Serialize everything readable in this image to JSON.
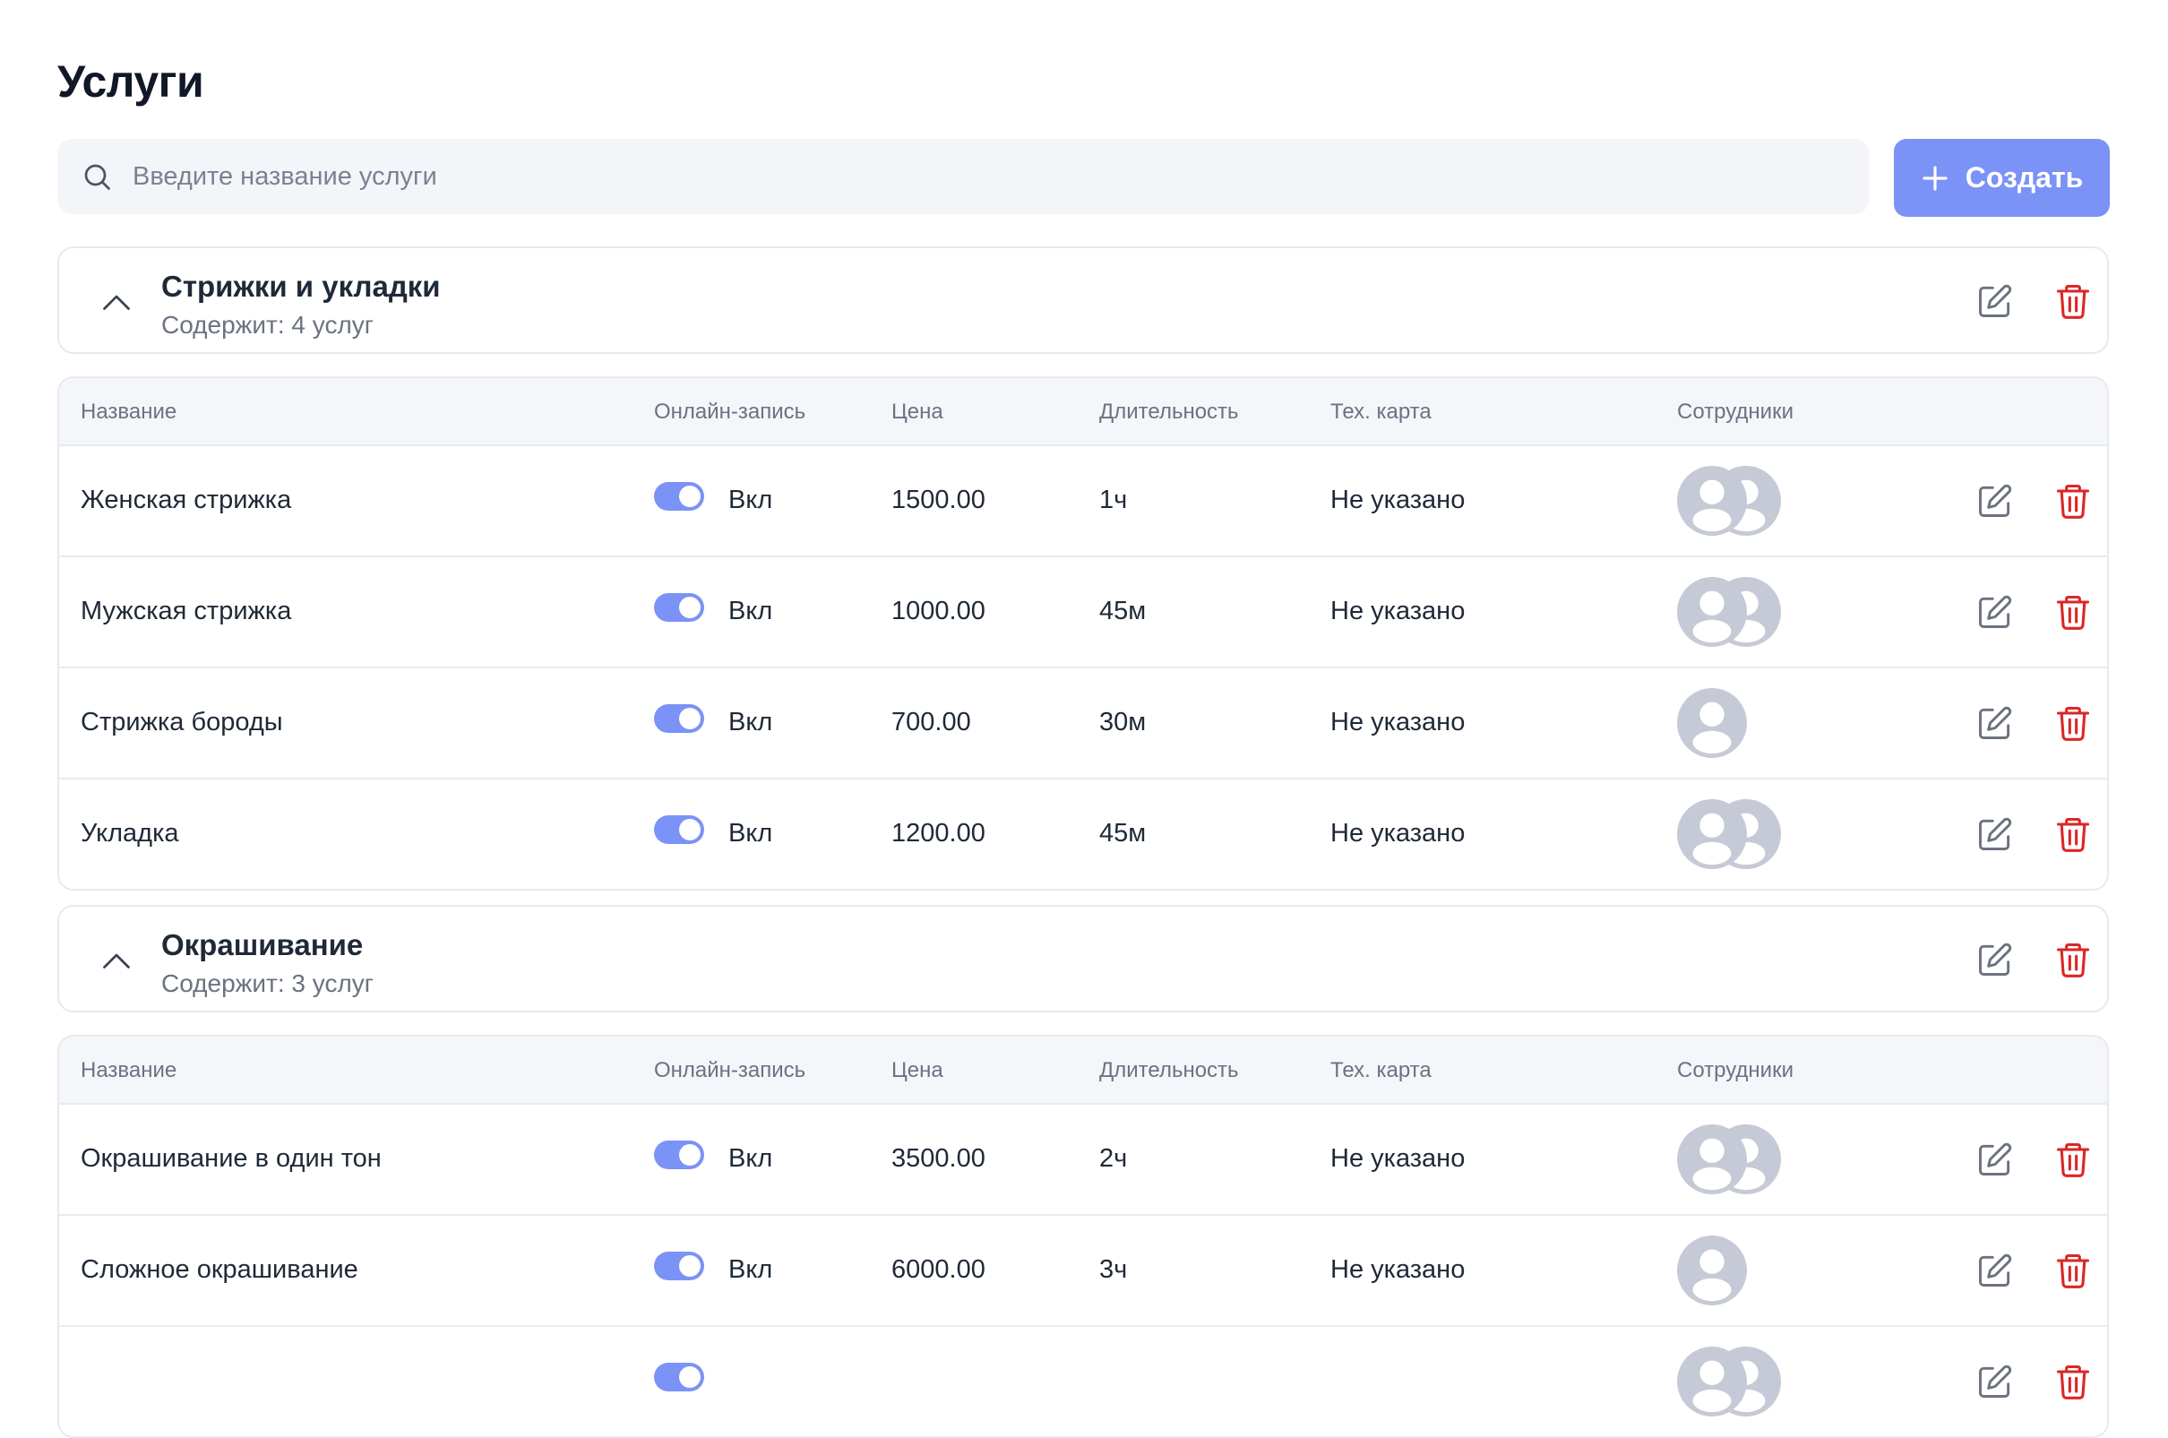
{
  "page": {
    "title": "Услуги"
  },
  "search": {
    "placeholder": "Введите название услуги",
    "icon": "search-icon"
  },
  "create_button": {
    "label": "Создать",
    "icon": "plus-icon"
  },
  "columns": {
    "name": "Название",
    "online": "Онлайн-запись",
    "price": "Цена",
    "duration": "Длительность",
    "tech_card": "Тех. карта",
    "staff": "Сотрудники"
  },
  "colors": {
    "accent": "#7b92f6",
    "danger": "#dc2626",
    "avatar": "#c5cad6"
  },
  "groups": [
    {
      "title": "Стрижки и укладки",
      "subtitle": "Содержит: 4 услуг",
      "services": [
        {
          "name": "Женская стрижка",
          "online": true,
          "online_label": "Вкл",
          "price": "1500.00",
          "duration": "1ч",
          "tech_card": "Не указано",
          "staff_count": 2
        },
        {
          "name": "Мужская стрижка",
          "online": true,
          "online_label": "Вкл",
          "price": "1000.00",
          "duration": "45м",
          "tech_card": "Не указано",
          "staff_count": 2
        },
        {
          "name": "Стрижка бороды",
          "online": true,
          "online_label": "Вкл",
          "price": "700.00",
          "duration": "30м",
          "tech_card": "Не указано",
          "staff_count": 1
        },
        {
          "name": "Укладка",
          "online": true,
          "online_label": "Вкл",
          "price": "1200.00",
          "duration": "45м",
          "tech_card": "Не указано",
          "staff_count": 2
        }
      ]
    },
    {
      "title": "Окрашивание",
      "subtitle": "Содержит: 3 услуг",
      "services": [
        {
          "name": "Окрашивание в один тон",
          "online": true,
          "online_label": "Вкл",
          "price": "3500.00",
          "duration": "2ч",
          "tech_card": "Не указано",
          "staff_count": 2
        },
        {
          "name": "Сложное окрашивание",
          "online": true,
          "online_label": "Вкл",
          "price": "6000.00",
          "duration": "3ч",
          "tech_card": "Не указано",
          "staff_count": 1
        },
        {
          "name": "",
          "online": true,
          "online_label": "",
          "price": "",
          "duration": "",
          "tech_card": "",
          "staff_count": 2
        }
      ]
    }
  ]
}
